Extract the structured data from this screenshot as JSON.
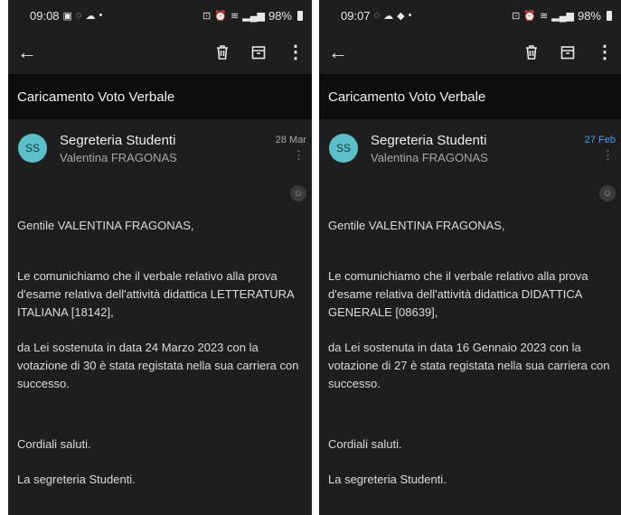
{
  "left": {
    "status": {
      "time": "09:08",
      "battery": "98%"
    },
    "subject": "Caricamento Voto Verbale",
    "sender": {
      "initials": "SS",
      "name": "Segreteria Studenti",
      "recipient": "Valentina FRAGONAS",
      "date": "28 Mar"
    },
    "greeting": "Gentile VALENTINA FRAGONAS,",
    "paragraph1": "Le comunichiamo che il verbale relativo alla prova d'esame relativa dell'attività didattica LETTERATURA ITALIANA [18142],",
    "paragraph2": "da Lei sostenuta in data 24 Marzo 2023 con la votazione di  30 è stata registata nella sua carriera con successo.",
    "closing": "Cordiali saluti.",
    "signature": "La segreteria Studenti."
  },
  "right": {
    "status": {
      "time": "09:07",
      "battery": "98%"
    },
    "subject": "Caricamento Voto Verbale",
    "sender": {
      "initials": "SS",
      "name": "Segreteria Studenti",
      "recipient": "Valentina FRAGONAS",
      "date": "27 Feb"
    },
    "greeting": "Gentile VALENTINA FRAGONAS,",
    "paragraph1": "Le comunichiamo che il verbale relativo alla prova d'esame relativa dell'attività didattica DIDATTICA GENERALE [08639],",
    "paragraph2": "da Lei sostenuta in data 16 Gennaio 2023 con la votazione di  27 è stata registata nella sua carriera con successo.",
    "closing": "Cordiali saluti.",
    "signature": "La segreteria Studenti."
  },
  "icons": {
    "back": "arrow-left-icon",
    "delete": "trash-icon",
    "archive": "archive-icon",
    "more": "more-vertical-icon",
    "emoji": "emoji-icon"
  },
  "colors": {
    "background": "#1e1e1e",
    "subject_bar": "#0d0d0d",
    "avatar": "#5bc0c8",
    "date_highlight": "#4f9df5"
  }
}
